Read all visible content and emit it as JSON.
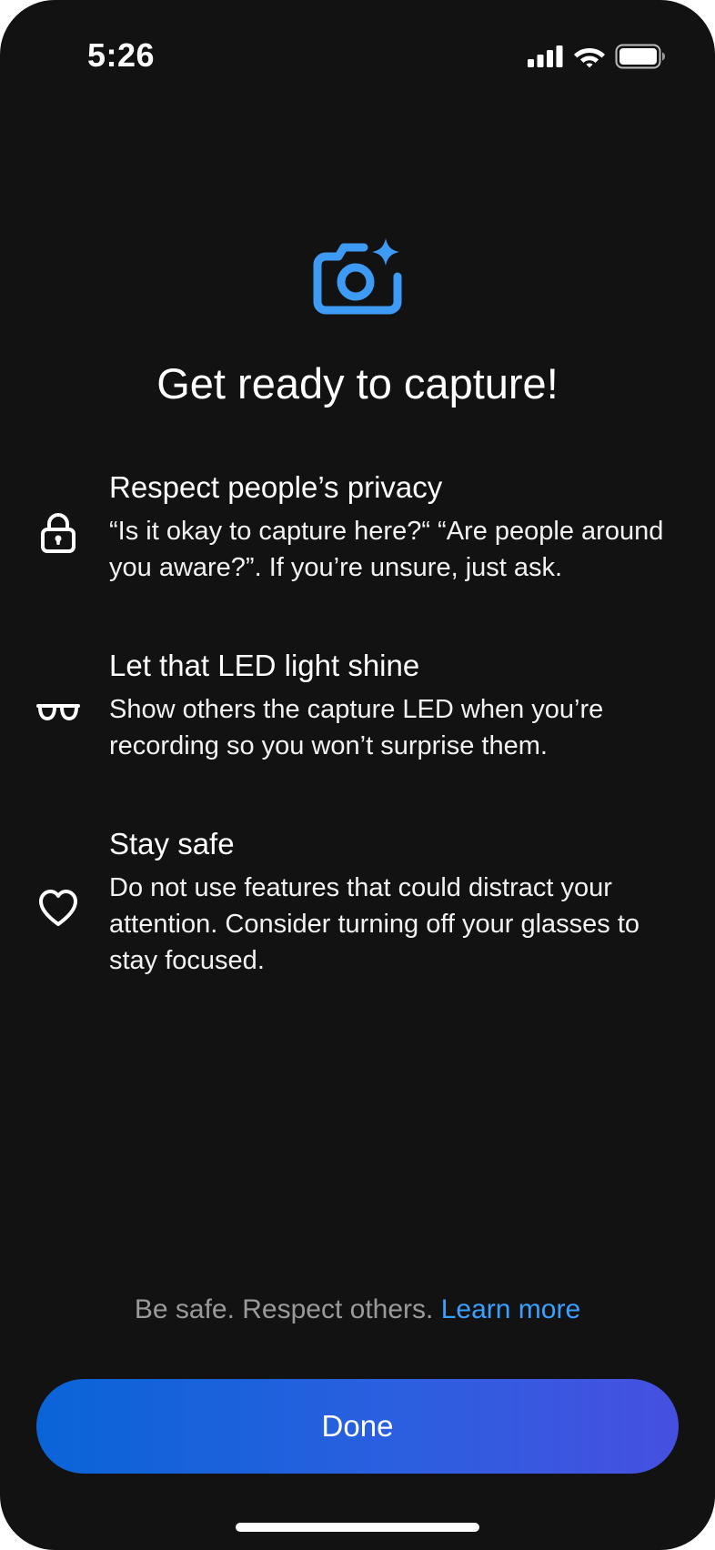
{
  "status_bar": {
    "time": "5:26",
    "signal_icon": "cellular-signal-icon",
    "wifi_icon": "wifi-icon",
    "battery_icon": "battery-icon"
  },
  "hero": {
    "icon": "camera-sparkle-icon",
    "icon_color": "#3d9bf5",
    "title": "Get ready to capture!"
  },
  "items": [
    {
      "icon": "lock-icon",
      "title": "Respect people’s privacy",
      "body": "“Is it okay to capture here?“ “Are people around you aware?”. If you’re unsure, just ask."
    },
    {
      "icon": "glasses-icon",
      "title": "Let that LED light shine",
      "body": "Show others the capture LED when you’re recording so you won’t surprise them."
    },
    {
      "icon": "heart-icon",
      "title": "Stay safe",
      "body": "Do not use features that could distract your attention. Consider turning off your glasses to stay focused."
    }
  ],
  "footer": {
    "note": "Be safe. Respect others.",
    "link": "Learn more",
    "link_color": "#3aa0ff"
  },
  "done_button": {
    "label": "Done"
  },
  "colors": {
    "background": "#121212",
    "accent": "#3d9bf5",
    "button_gradient_start": "#0a64d8",
    "button_gradient_end": "#4650e0"
  }
}
